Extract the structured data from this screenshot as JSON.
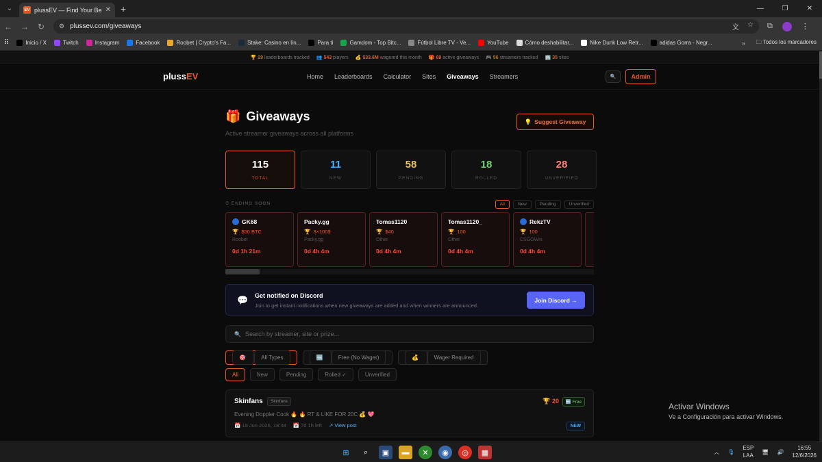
{
  "browser": {
    "tab_title": "plussEV — Find Your Best Leade",
    "url": "plussev.com/giveaways",
    "bookmarks": [
      {
        "label": "Inicio / X",
        "icon": "x-icon",
        "color": "#000000"
      },
      {
        "label": "Twitch",
        "icon": "twitch-icon",
        "color": "#9146ff"
      },
      {
        "label": "Instagram",
        "icon": "instagram-icon",
        "color": "#d6249f"
      },
      {
        "label": "Facebook",
        "icon": "facebook-icon",
        "color": "#1877f2"
      },
      {
        "label": "Roobet | Crypto's Fa...",
        "icon": "roobet-icon",
        "color": "#e8a92a"
      },
      {
        "label": "Stake: Casino en lín...",
        "icon": "stake-icon",
        "color": "#1a2c38"
      },
      {
        "label": "Para ti",
        "icon": "x-icon",
        "color": "#000000"
      },
      {
        "label": "Gamdom - Top Bitc...",
        "icon": "gamdom-icon",
        "color": "#16a34a"
      },
      {
        "label": "Fútbol Libre TV - Ve...",
        "icon": "globe-icon",
        "color": "#888888"
      },
      {
        "label": "YouTube",
        "icon": "youtube-icon",
        "color": "#ff0000"
      },
      {
        "label": "Cómo deshabilitar...",
        "icon": "info-icon",
        "color": "#dddddd"
      },
      {
        "label": "Nike Dunk Low Retr...",
        "icon": "nike-icon",
        "color": "#ffffff"
      },
      {
        "label": "adidas Gorra - Negr...",
        "icon": "adidas-icon",
        "color": "#000000"
      }
    ],
    "all_bookmarks": "Todos los marcadores"
  },
  "statbar": {
    "leaderboards": "29",
    "leaderboards_lbl": "leaderboards tracked",
    "players": "543",
    "players_lbl": "players",
    "wagered": "$33.6M",
    "wagered_lbl": "wagered this month",
    "giveaways": "69",
    "giveaways_lbl": "active giveaways",
    "streamers": "56",
    "streamers_lbl": "streamers tracked",
    "sites": "35",
    "sites_lbl": "sites"
  },
  "nav": {
    "logo_a": "pluss",
    "logo_b": "EV",
    "links": [
      "Home",
      "Leaderboards",
      "Calculator",
      "Sites",
      "Giveaways",
      "Streamers"
    ],
    "active": "Giveaways",
    "admin": "Admin"
  },
  "header": {
    "title": "Giveaways",
    "subtitle": "Active streamer giveaways across all platforms",
    "suggest": "Suggest Giveaway"
  },
  "stats": [
    {
      "value": "115",
      "label": "TOTAL",
      "color": "#ffffff"
    },
    {
      "value": "11",
      "label": "NEW",
      "color": "#4ab3ff"
    },
    {
      "value": "58",
      "label": "PENDING",
      "color": "#f0c060"
    },
    {
      "value": "18",
      "label": "ROLLED",
      "color": "#6fd36f"
    },
    {
      "value": "28",
      "label": "UNVERIFIED",
      "color": "#ff8070"
    }
  ],
  "ending_soon": {
    "label": "ENDING SOON",
    "filters": [
      "All",
      "New",
      "Pending",
      "Unverified"
    ],
    "cards": [
      {
        "name": "GK68",
        "prize": "$50 BTC",
        "site": "Roobet",
        "time": "0d 1h 21m",
        "avatar": true
      },
      {
        "name": "Packy.gg",
        "prize": "3×100$",
        "site": "Packy.gg",
        "time": "0d 4h 4m",
        "avatar": false
      },
      {
        "name": "Tomas1120",
        "prize": "$40",
        "site": "Other",
        "time": "0d 4h 4m",
        "avatar": false
      },
      {
        "name": "Tomas1120_",
        "prize": "100",
        "site": "Other",
        "time": "0d 4h 4m",
        "avatar": false
      },
      {
        "name": "RekzTV",
        "prize": "100",
        "site": "CSGOWin",
        "time": "0d 4h 4m",
        "avatar": true
      }
    ]
  },
  "discord": {
    "title": "Get notified on Discord",
    "text": "Join to get instant notifications when new giveaways are added and when winners are announced.",
    "button": "Join Discord →"
  },
  "search": {
    "placeholder": "Search by streamer, site or prize..."
  },
  "type_filters": [
    "All Types",
    "Free (No Wager)",
    "Wager Required"
  ],
  "status_filters": [
    "All",
    "New",
    "Pending",
    "Rolled ✓",
    "Unverified"
  ],
  "entry": {
    "name": "Skinfans",
    "tag": "Skinfans",
    "desc": "Evening Doppler Cook 🔥 🔥 RT & LIKE FOR 20C 💰 💖",
    "date": "19 Jun 2026, 18:48",
    "left": "7d 1h left",
    "link": "↗ View post",
    "prize": "20",
    "free": "Free",
    "status": "NEW"
  },
  "windows": {
    "activate_title": "Activar Windows",
    "activate_sub": "Ve a Configuración para activar Windows.",
    "lang_a": "ESP",
    "lang_b": "LAA",
    "time": "16:55",
    "date": "12/6/2026"
  }
}
